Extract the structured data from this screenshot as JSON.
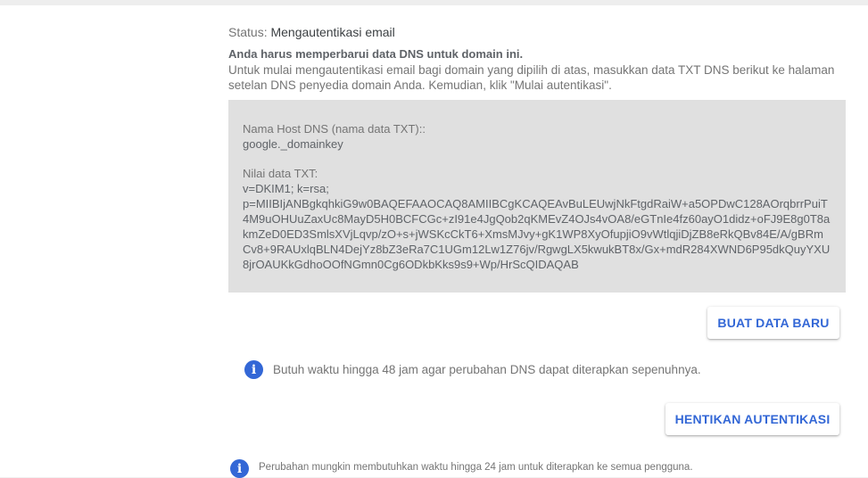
{
  "status": {
    "label": "Status:",
    "value": "Mengautentikasi email"
  },
  "notice": {
    "title": "Anda harus memperbarui data DNS untuk domain ini.",
    "body": "Untuk mulai mengautentikasi email bagi domain yang dipilih di atas, masukkan data TXT DNS berikut ke halaman setelan DNS penyedia domain Anda. Kemudian, klik \"Mulai autentikasi\"."
  },
  "dns_record": {
    "host_label": "Nama Host DNS (nama data TXT)::",
    "host_value": "google._domainkey",
    "txt_label": "Nilai data TXT:",
    "txt_line1": "v=DKIM1; k=rsa;",
    "txt_value": "p=MIIBIjANBgkqhkiG9w0BAQEFAAOCAQ8AMIIBCgKCAQEAvBuLEUwjNkFtgdRaiW+a5OPDwC128AOrqbrrPuiT4M9uOHUuZaxUc8MayD5H0BCFCGc+zI91e4JgQob2qKMEvZ4OJs4vOA8/eGTnIe4fz60ayO1didz+oFJ9E8g0T8akmZeD0ED3SmlsXVjLqvp/zO+s+jWSKcCkT6+XmsMJvy+gK1WP8XyOfupjiO9vWtlqjiDjZB8eRkQBv84E/A/gBRmCv8+9RAUxlqBLN4DejYz8bZ3eRa7C1UGm12Lw1Z76jv/RgwgLX5kwukBT8x/Gx+mdR284XWND6P95dkQuyYXU8jrOAUKkGdhoOOfNGmn0Cg6ODkbKks9s9+Wp/HrScQIDAQAB"
  },
  "buttons": {
    "new_record": "BUAT DATA BARU",
    "stop_auth": "HENTIKAN AUTENTIKASI"
  },
  "info": {
    "dns_time": "Butuh waktu hingga 48 jam agar perubahan DNS dapat diterapkan sepenuhnya.",
    "user_time": "Perubahan mungkin membutuhkan waktu hingga 24 jam untuk diterapkan ke semua pengguna."
  },
  "icons": {
    "info": "info-icon"
  },
  "colors": {
    "accent": "#3367d6",
    "record_box": "#e0e0e0",
    "text": "#757575"
  }
}
